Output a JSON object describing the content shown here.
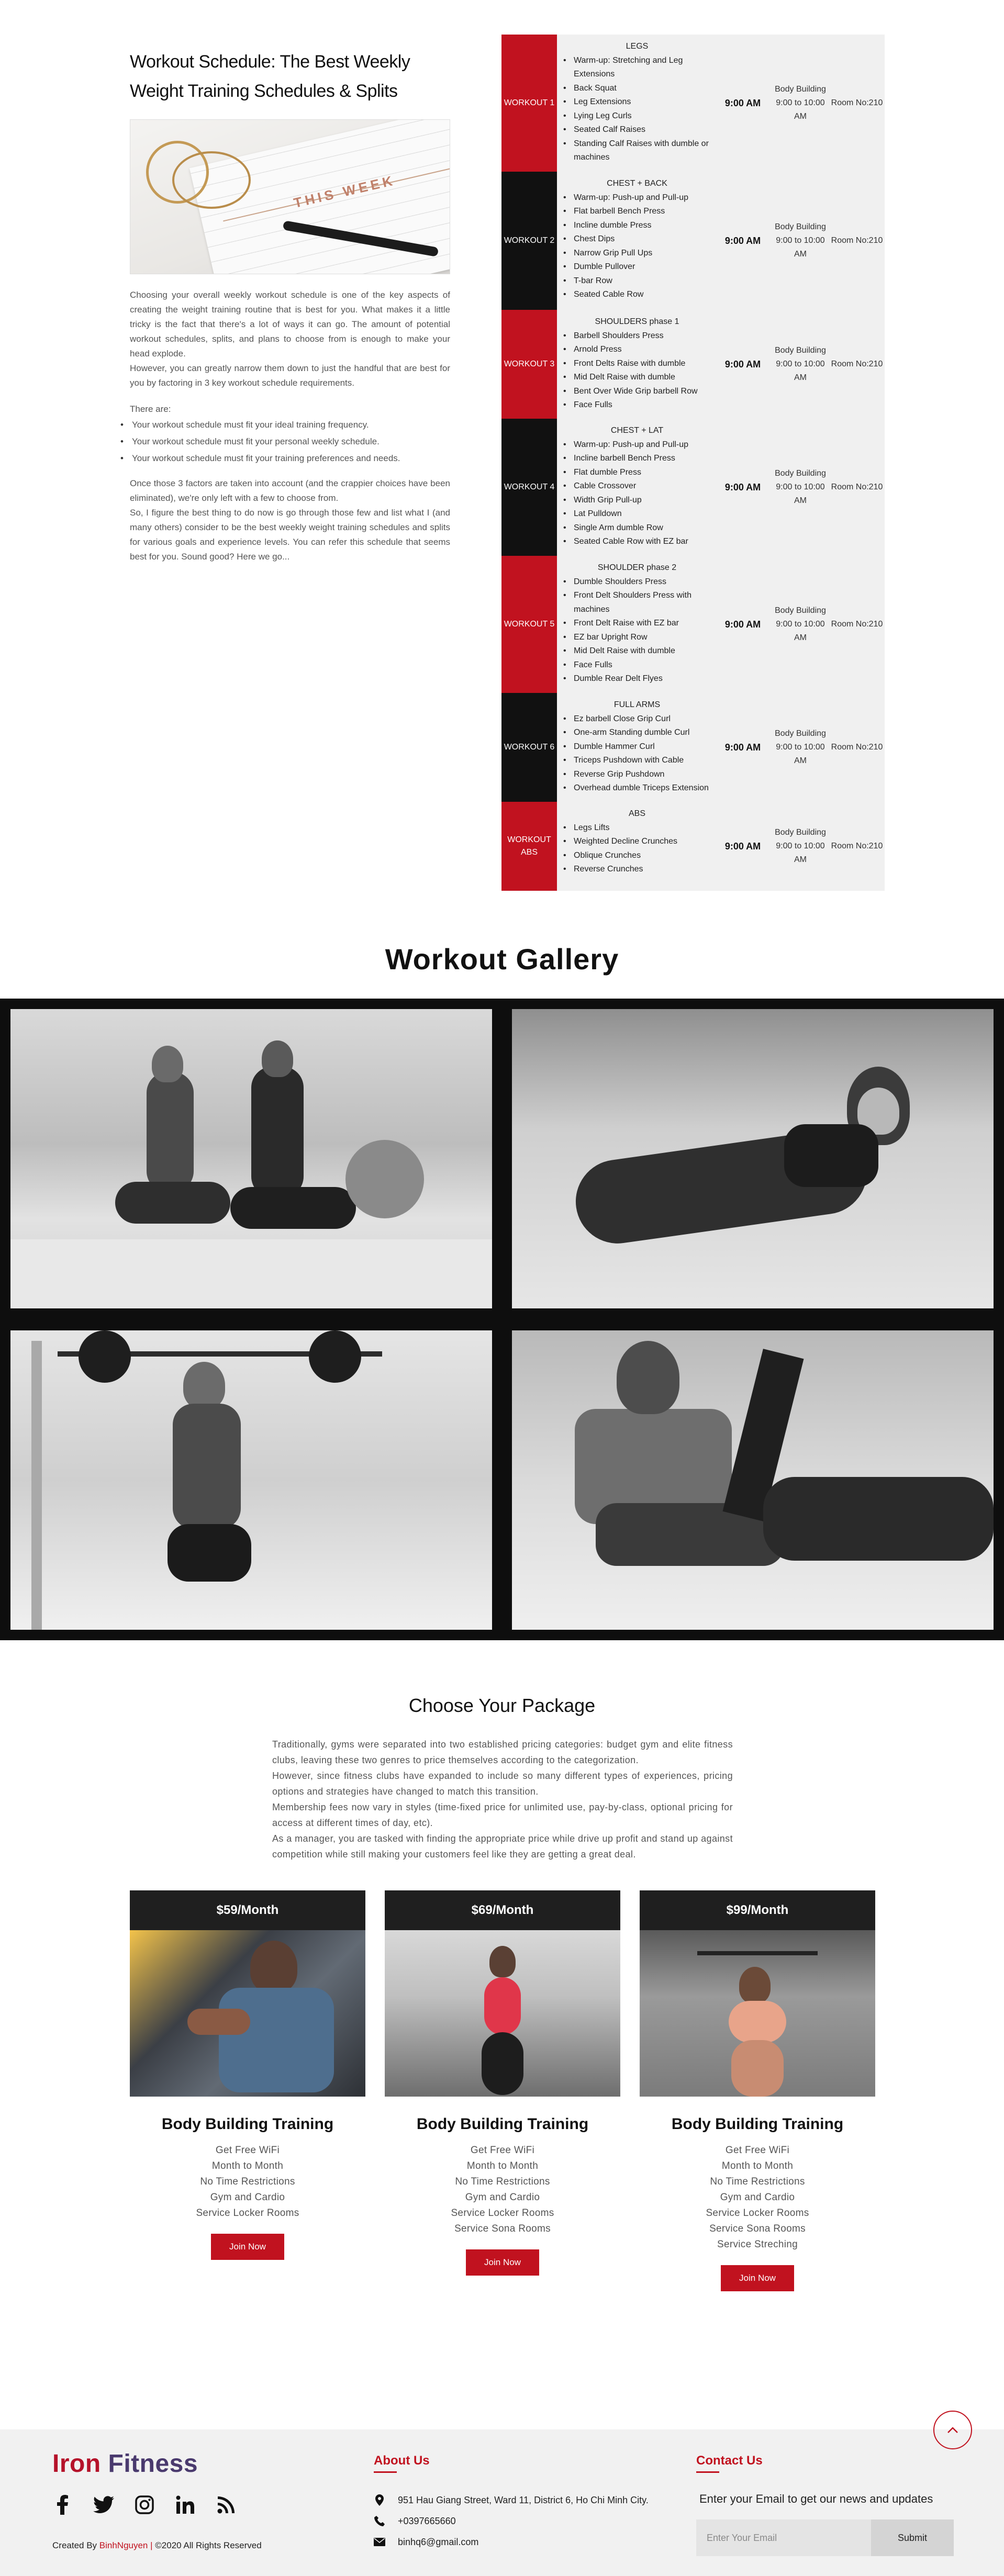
{
  "schedule": {
    "heading": "Workout Schedule: The Best Weekly Weight Training Schedules & Splits",
    "image_text": "THIS WEEK",
    "p1": "Choosing your overall weekly workout schedule is one of the key aspects of creating the weight training routine that is best for you. What makes it a little tricky is the fact that there's a lot of ways it can go. The amount of potential workout schedules, splits, and plans to choose from is enough to make your head explode.",
    "p2": "However, you can greatly narrow them down to just the handful that are best for you by factoring in 3 key workout schedule requirements.",
    "there_are": "There are:",
    "requirements": [
      "Your workout schedule must fit your ideal training frequency.",
      "Your workout schedule must fit your personal weekly schedule.",
      "Your workout schedule must fit your training preferences and needs."
    ],
    "p3": "Once those 3 factors are taken into account (and the crappier choices have been eliminated), we're only left with a few to choose from.",
    "p4": "So, I figure the best thing to do now is go through those few and list what I (and many others) consider to be the best weekly weight training schedules and splits for various goals and experience levels. You can refer this schedule that seems best for you. Sound good? Here we go...",
    "rows": [
      {
        "label": "WORKOUT 1",
        "title": "LEGS",
        "items": [
          "Warm-up: Stretching and Leg Extensions",
          "Back Squat",
          "Leg Extensions",
          "Lying Leg Curls",
          "Seated Calf Raises",
          "Standing Calf Raises with dumble or machines"
        ],
        "time": "9:00 AM",
        "class": "Body Building 9:00 to 10:00 AM",
        "room": "Room No:210"
      },
      {
        "label": "WORKOUT 2",
        "title": "CHEST + BACK",
        "items": [
          "Warm-up: Push-up and Pull-up",
          "Flat barbell Bench Press",
          "Incline dumble Press",
          "Chest Dips",
          "Narrow Grip Pull Ups",
          "Dumble Pullover",
          "T-bar Row",
          "Seated Cable Row"
        ],
        "time": "9:00 AM",
        "class": "Body Building 9:00 to 10:00 AM",
        "room": "Room No:210"
      },
      {
        "label": "WORKOUT 3",
        "title": "SHOULDERS phase 1",
        "items": [
          "Barbell Shoulders Press",
          "Arnold Press",
          "Front Delts Raise with dumble",
          "Mid Delt Raise with dumble",
          "Bent Over Wide Grip barbell Row",
          "Face Fulls"
        ],
        "time": "9:00 AM",
        "class": "Body Building 9:00 to 10:00 AM",
        "room": "Room No:210"
      },
      {
        "label": "WORKOUT 4",
        "title": "CHEST + LAT",
        "items": [
          "Warm-up: Push-up and Pull-up",
          "Incline barbell Bench Press",
          "Flat dumble Press",
          "Cable Crossover",
          "Width Grip Pull-up",
          "Lat Pulldown",
          "Single Arm dumble Row",
          "Seated Cable Row with EZ bar"
        ],
        "time": "9:00 AM",
        "class": "Body Building 9:00 to 10:00 AM",
        "room": "Room No:210"
      },
      {
        "label": "WORKOUT 5",
        "title": "SHOULDER phase 2",
        "items": [
          "Dumble Shoulders Press",
          "Front Delt Shoulders Press with machines",
          "Front Delt Raise with EZ bar",
          "EZ bar Upright Row",
          "Mid Delt Raise with dumble",
          "Face Fulls",
          "Dumble Rear Delt Flyes"
        ],
        "time": "9:00 AM",
        "class": "Body Building 9:00 to 10:00 AM",
        "room": "Room No:210"
      },
      {
        "label": "WORKOUT 6",
        "title": "FULL ARMS",
        "items": [
          "Ez barbell Close Grip Curl",
          "One-arm Standing dumble Curl",
          "Dumble Hammer Curl",
          "Triceps Pushdown with Cable",
          "Reverse Grip Pushdown",
          "Overhead dumble Triceps Extension"
        ],
        "time": "9:00 AM",
        "class": "Body Building 9:00 to 10:00 AM",
        "room": "Room No:210"
      },
      {
        "label": "WORKOUT ABS",
        "title": "ABS",
        "items": [
          "Legs Lifts",
          "Weighted Decline Crunches",
          "Oblique Crunches",
          "Reverse Crunches"
        ],
        "time": "9:00 AM",
        "class": "Body Building 9:00 to 10:00 AM",
        "room": "Room No:210"
      }
    ]
  },
  "gallery": {
    "title": "Workout Gallery"
  },
  "packages": {
    "title": "Choose Your Package",
    "text1": "Traditionally, gyms were separated into two established pricing categories: budget gym and elite fitness clubs, leaving these two genres to price themselves according to the categorization.",
    "text2": "However, since fitness clubs have expanded to include so many different types of experiences, pricing options and strategies have changed to match this transition.",
    "text3": "Membership fees now vary in styles (time-fixed price for unlimited use, pay-by-class, optional pricing for access at different times of day, etc).",
    "text4": "As a manager, you are tasked with finding the appropriate price while drive up profit and stand up against competition while still making your customers feel like they are getting a great deal.",
    "cards": [
      {
        "price": "$59/Month",
        "title": "Body Building Training",
        "features": [
          "Get Free WiFi",
          "Month to Month",
          "No Time Restrictions",
          "Gym and Cardio",
          "Service Locker Rooms"
        ],
        "button": "Join Now"
      },
      {
        "price": "$69/Month",
        "title": "Body Building Training",
        "features": [
          "Get Free WiFi",
          "Month to Month",
          "No Time Restrictions",
          "Gym and Cardio",
          "Service Locker Rooms",
          "Service Sona Rooms"
        ],
        "button": "Join Now"
      },
      {
        "price": "$99/Month",
        "title": "Body Building Training",
        "features": [
          "Get Free WiFi",
          "Month to Month",
          "No Time Restrictions",
          "Gym and Cardio",
          "Service Locker Rooms",
          "Service Sona Rooms",
          "Service Streching"
        ],
        "button": "Join Now"
      }
    ]
  },
  "footer": {
    "brand_part1": "Iron ",
    "brand_part2": "Fitness",
    "social": [
      "facebook-icon",
      "twitter-icon",
      "instagram-icon",
      "linkedin-icon",
      "rss-icon"
    ],
    "credit_prefix": "Created By ",
    "credit_author": "BinhNguyen",
    "credit_sep": " | ",
    "credit_suffix": "©2020 All Rights Reserved",
    "about_title": "About Us",
    "address": "951 Hau Giang Street, Ward 11, District 6, Ho Chi Minh City.",
    "phone": "+0397665660",
    "email": "binhq6@gmail.com",
    "contact_title": "Contact Us",
    "newsletter": "Enter your Email to get our news and updates",
    "email_placeholder": "Enter Your Email",
    "submit": "Submit"
  },
  "colors": {
    "accent": "#c1121f",
    "dark": "#111111",
    "panel": "#f0f0f0"
  }
}
